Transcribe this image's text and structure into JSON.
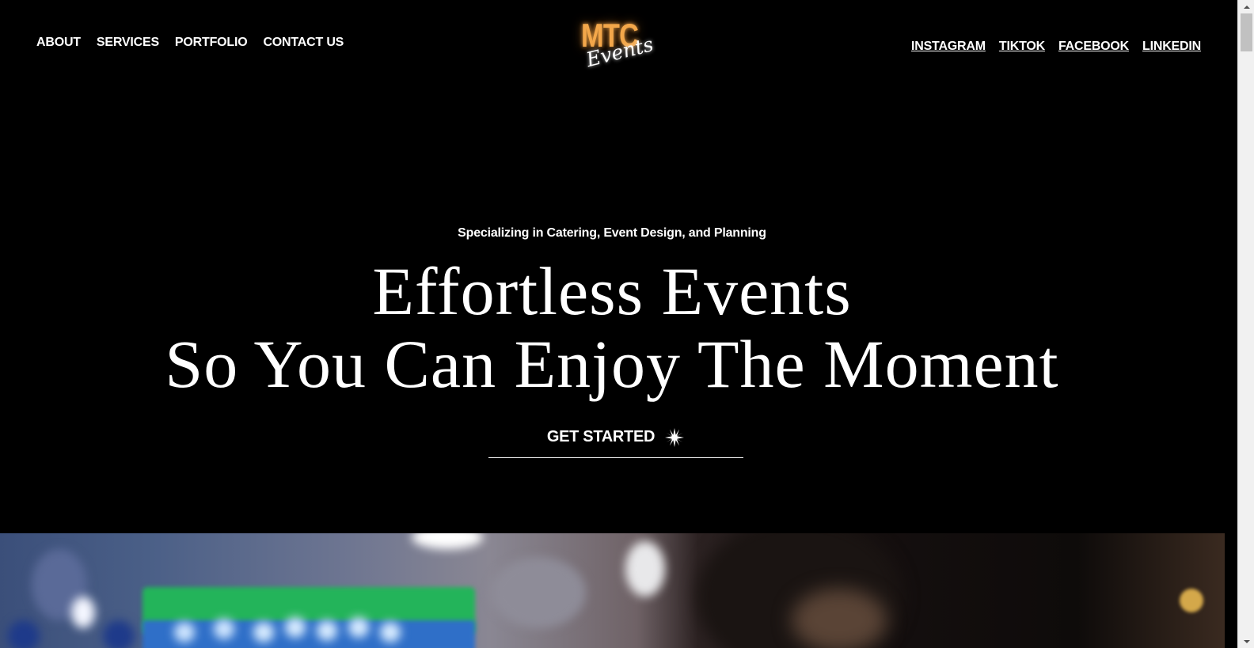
{
  "nav": {
    "left": [
      {
        "label": "ABOUT"
      },
      {
        "label": "SERVICES"
      },
      {
        "label": "PORTFOLIO"
      },
      {
        "label": "CONTACT US"
      }
    ],
    "right": [
      {
        "label": "INSTAGRAM"
      },
      {
        "label": "TIKTOK"
      },
      {
        "label": "FACEBOOK"
      },
      {
        "label": "LINKEDIN"
      }
    ]
  },
  "logo": {
    "primary": "MTC",
    "secondary": "Events",
    "primary_color": "#f3a74a"
  },
  "hero": {
    "tagline": "Specializing in Catering, Event Design, and Planning",
    "headline_line1": "Effortless Events",
    "headline_line2": "So You Can Enjoy The Moment",
    "cta_label": "GET STARTED",
    "cta_icon": "starburst-icon"
  },
  "colors": {
    "background": "#000000",
    "text": "#ffffff",
    "accent": "#f3a74a"
  }
}
